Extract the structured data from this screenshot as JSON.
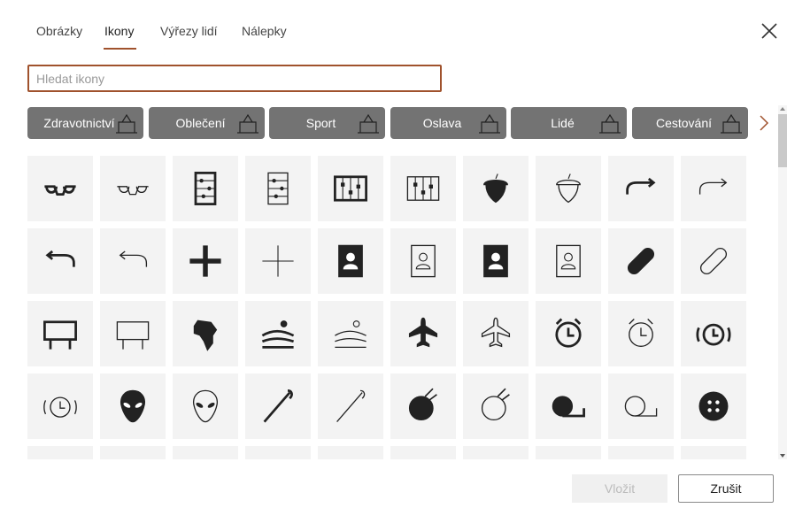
{
  "tabs": [
    {
      "label": "Obrázky"
    },
    {
      "label": "Ikony",
      "active": true
    },
    {
      "label": "Výřezy lidí"
    },
    {
      "label": "Nálepky"
    }
  ],
  "search": {
    "placeholder": "Hledat ikony",
    "value": ""
  },
  "categories": [
    {
      "label": "Zdravotnictví",
      "icon": "hospital-bed"
    },
    {
      "label": "Oblečení",
      "icon": "crown"
    },
    {
      "label": "Sport",
      "icon": "skier"
    },
    {
      "label": "Oslava",
      "icon": "dragon-dance"
    },
    {
      "label": "Lidé",
      "icon": "crawling-baby"
    },
    {
      "label": "Cestování",
      "icon": "escalator"
    }
  ],
  "icons": [
    "3d-glasses",
    "3d-glasses-outline",
    "abacus",
    "abacus-outline",
    "abacus-wide",
    "abacus-wide-outline",
    "acorn",
    "acorn-outline",
    "curved-arrow-right",
    "curved-arrow-right-outline",
    "curved-arrow-left",
    "curved-arrow-left-outline",
    "plus",
    "plus-outline",
    "address-book",
    "address-book-outline",
    "address-book-dark",
    "address-book-dark-outline",
    "bandage",
    "bandage-outline",
    "billboard",
    "billboard-outline",
    "africa",
    "landscape",
    "landscape-outline",
    "airplane",
    "airplane-outline",
    "alarm-clock",
    "alarm-clock-outline",
    "alarm-ringing",
    "alarm-ringing-outline",
    "alien",
    "alien-outline",
    "needle",
    "needle-outline",
    "yarn",
    "yarn-outline",
    "tape-measure",
    "tape-measure-outline",
    "button",
    "partial",
    "partial",
    "partial",
    "partial",
    "partial",
    "partial",
    "partial",
    "partial",
    "partial",
    "partial"
  ],
  "buttons": {
    "insert": "Vložit",
    "cancel": "Zrušit"
  },
  "colors": {
    "accent": "#a0522d",
    "category_bg": "#737373",
    "tile_bg": "#f3f3f3"
  }
}
